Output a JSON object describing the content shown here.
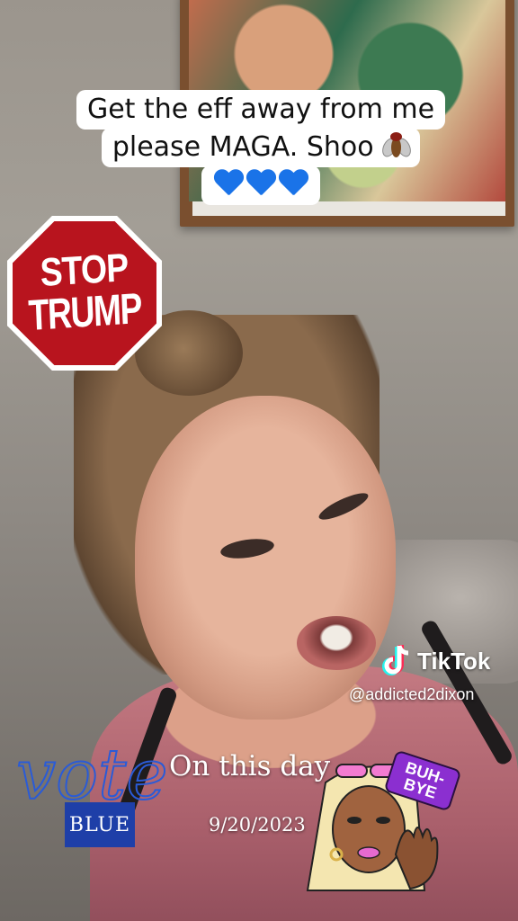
{
  "caption": {
    "line1": "Get the eff away from me",
    "line2": "please MAGA. Shoo",
    "fly_emoji": "fly-icon",
    "hearts": [
      "blue-heart-icon",
      "blue-heart-icon",
      "blue-heart-icon"
    ]
  },
  "stop_sign": {
    "word1": "STOP",
    "word2": "TRUMP"
  },
  "watermark": {
    "brand": "TikTok",
    "handle": "@addicted2dixon"
  },
  "vote_sticker": {
    "script": "vote",
    "box": "BLUE"
  },
  "on_this_day": {
    "title": "On this day",
    "date": "9/20/2023"
  },
  "bye_sticker": {
    "text": "BUH-BYE"
  },
  "colors": {
    "stop_red": "#b8141e",
    "heart_blue": "#1a73e8",
    "vote_blue": "#1e3fa8",
    "bye_purple": "#8b2fd0"
  }
}
